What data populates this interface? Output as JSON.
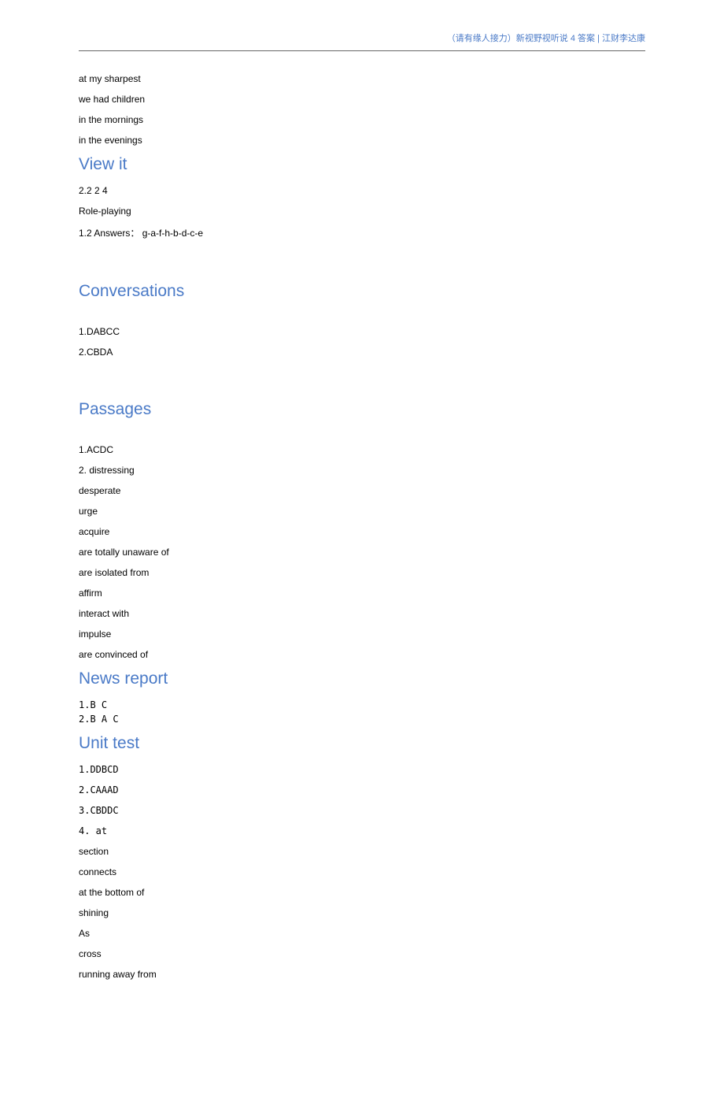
{
  "header": {
    "credit": "（请有缘人接力）新视野视听说 4 答案 | 江财李达康"
  },
  "intro_lines": [
    "at my sharpest",
    "we had children",
    "in the mornings",
    "in the evenings"
  ],
  "sections": [
    {
      "title": "View it",
      "lines": [
        "2.2 2 4",
        "Role-playing",
        " 1.2 Answers： g-a-f-h-b-d-c-e"
      ],
      "gap_after": "big"
    },
    {
      "title": "Conversations",
      "pre_gap": "med",
      "lines": [
        "  1.DABCC",
        "2.CBDA"
      ],
      "gap_after": "big"
    },
    {
      "title": "Passages",
      "pre_gap": "med",
      "lines": [
        "1.ACDC",
        "2. distressing",
        "desperate",
        "urge",
        "acquire",
        "are totally unaware of",
        "are isolated from",
        "affirm",
        "interact with",
        "impulse",
        "are convinced of"
      ]
    },
    {
      "title": "News report",
      "lines_mono": [
        "1.B C",
        "2.B A C"
      ]
    },
    {
      "title": "Unit test",
      "tight": true,
      "lines_mono_spaced": [
        "1.DDBCD",
        "2.CAAAD",
        "3.CBDDC",
        "4. at"
      ],
      "lines": [
        "section",
        "connects",
        "at the bottom of",
        "shining",
        "As",
        "cross",
        "running away from"
      ]
    }
  ]
}
